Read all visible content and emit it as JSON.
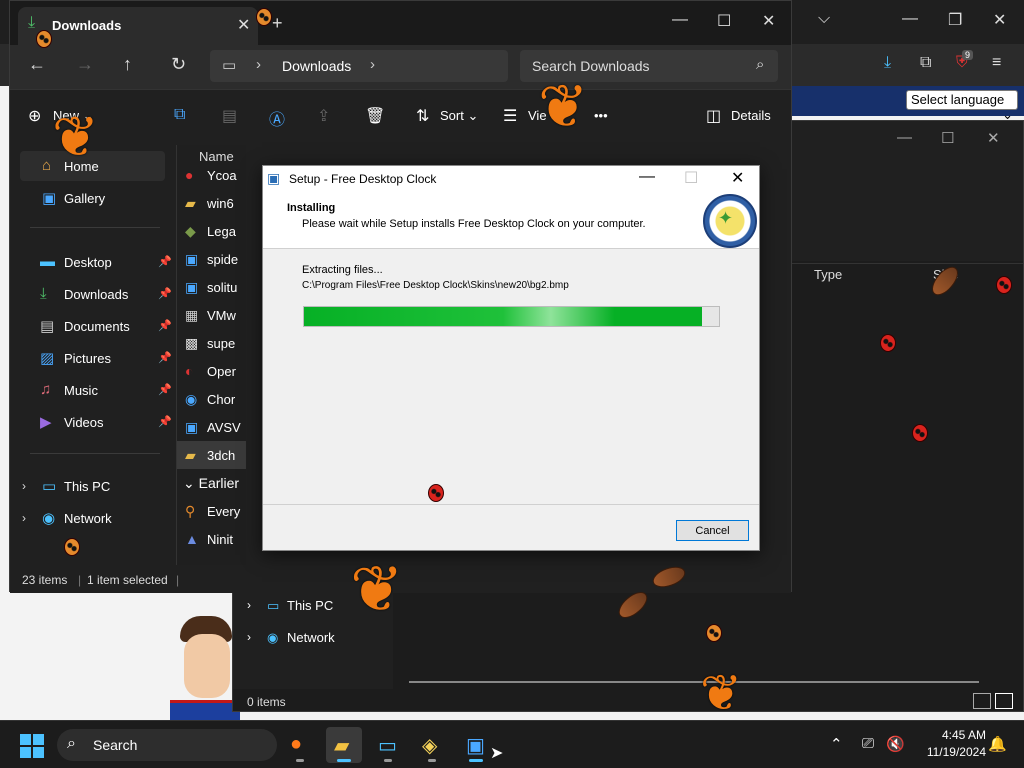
{
  "browser": {
    "language_select": "Select language",
    "extension_badge": "9"
  },
  "explorer_front": {
    "tab_title": "Downloads",
    "address_location": "Downloads",
    "search_placeholder": "Search Downloads",
    "commands": {
      "new": "New",
      "sort": "Sort",
      "view": "Vie",
      "more": "•••",
      "details": "Details"
    },
    "sidebar": {
      "home": "Home",
      "gallery": "Gallery",
      "pinned": [
        "Desktop",
        "Downloads",
        "Documents",
        "Pictures",
        "Music",
        "Videos"
      ],
      "this_pc": "This PC",
      "network": "Network"
    },
    "file_list": {
      "column_name": "Name",
      "files": [
        "Ycoa",
        "win6",
        "Lega",
        "spide",
        "solitu",
        "VMw",
        "supe",
        "Oper",
        "Chor",
        "AVSV",
        "3dch"
      ],
      "group_earlier": "Earlier",
      "earlier_files": [
        "Every",
        "Ninit"
      ]
    },
    "status": {
      "items": "23 items",
      "selected": "1 item selected"
    }
  },
  "explorer_back": {
    "columns": {
      "type": "Type",
      "size": "Size"
    },
    "nav": {
      "this_pc": "This PC",
      "network": "Network"
    },
    "status": "0 items"
  },
  "setup": {
    "title": "Setup - Free Desktop Clock",
    "heading": "Installing",
    "subheading": "Please wait while Setup installs Free Desktop Clock on your computer.",
    "status": "Extracting files...",
    "path": "C:\\Program Files\\Free Desktop Clock\\Skins\\new20\\bg2.bmp",
    "progress_percent": 96,
    "cancel_label": "Cancel"
  },
  "taskbar": {
    "search_label": "Search",
    "time": "4:45 AM",
    "date": "11/19/2024"
  }
}
